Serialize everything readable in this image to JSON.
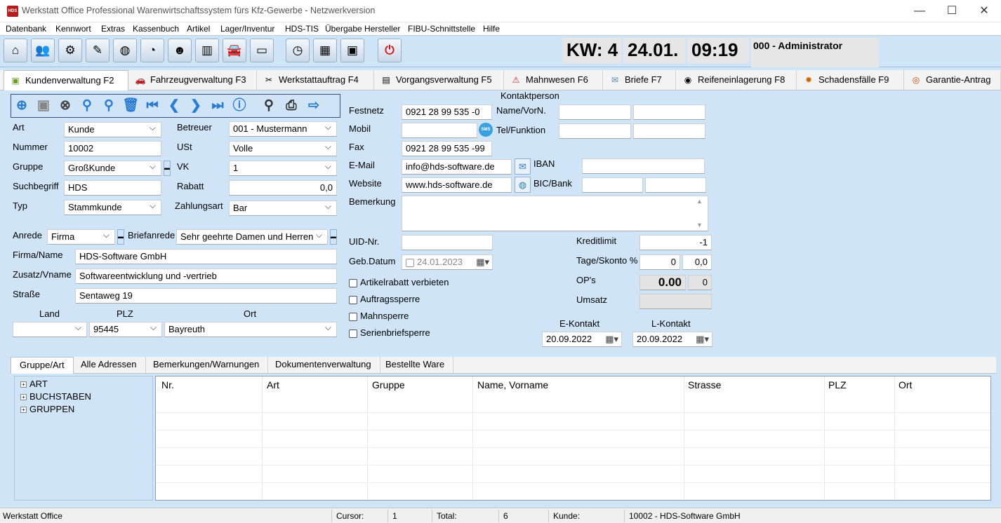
{
  "window": {
    "app_icon": "HDS",
    "title": "Werkstatt Office Professional Warenwirtschaftssystem fürs Kfz-Gewerbe - Netzwerkversion",
    "min": "—",
    "max": "☐",
    "close": "✕"
  },
  "menu": [
    "Datenbank",
    "Kennwort",
    "Extras",
    "Kassenbuch",
    "Artikel",
    "Lager/Inventur",
    "HDS-TIS",
    "Übergabe Hersteller",
    "FIBU-Schnittstelle",
    "Hilfe"
  ],
  "toolbar_icons": [
    "home-icon",
    "users-icon",
    "gear-icon",
    "notes-icon",
    "globe-icon",
    "pie-chart-icon",
    "person-icon",
    "bar-chart-icon",
    "car-icon",
    "scanner-icon",
    "clock-icon",
    "calendar-icon",
    "package-icon",
    "power-icon"
  ],
  "info": {
    "week": "KW: 4",
    "date": "24.01.",
    "time": "09:19",
    "user": "000 - Administrator"
  },
  "tabs": [
    {
      "label": "Kundenverwaltung F2",
      "icon": "customer-icon",
      "glyph": "▣",
      "active": true
    },
    {
      "label": "Fahrzeugverwaltung F3",
      "icon": "car-icon",
      "glyph": "🚗",
      "active": false
    },
    {
      "label": "Werkstattauftrag F4",
      "icon": "tools-icon",
      "glyph": "✂",
      "active": false
    },
    {
      "label": "Vorgangsverwaltung F5",
      "icon": "document-icon",
      "glyph": "▤",
      "active": false
    },
    {
      "label": "Mahnwesen F6",
      "icon": "warning-icon",
      "glyph": "⚠",
      "active": false
    },
    {
      "label": "Briefe F7",
      "icon": "envelope-icon",
      "glyph": "✉",
      "active": false
    },
    {
      "label": "Reifeneinlagerung F8",
      "icon": "tire-icon",
      "glyph": "◉",
      "active": false
    },
    {
      "label": "Schadensfälle F9",
      "icon": "damage-icon",
      "glyph": "✹",
      "active": false
    },
    {
      "label": "Garantie-Antrag",
      "icon": "warranty-icon",
      "glyph": "◎",
      "active": false
    }
  ],
  "form": {
    "art": {
      "label": "Art",
      "value": "Kunde"
    },
    "nummer": {
      "label": "Nummer",
      "value": "10002"
    },
    "gruppe": {
      "label": "Gruppe",
      "value": "GroßKunde"
    },
    "suchbegriff": {
      "label": "Suchbegriff",
      "value": "HDS"
    },
    "typ": {
      "label": "Typ",
      "value": "Stammkunde"
    },
    "betreuer": {
      "label": "Betreuer",
      "value": "001 - Mustermann"
    },
    "ust": {
      "label": "USt",
      "value": "Volle"
    },
    "vk": {
      "label": "VK",
      "value": "1"
    },
    "rabatt": {
      "label": "Rabatt",
      "value": "0,0"
    },
    "zahlungsart": {
      "label": "Zahlungsart",
      "value": "Bar"
    },
    "anrede": {
      "label": "Anrede",
      "value": "Firma"
    },
    "briefanrede": {
      "label": "Briefanrede",
      "value": "Sehr geehrte Damen und Herren"
    },
    "firma": {
      "label": "Firma/Name",
      "value": "HDS-Software GmbH"
    },
    "zusatz": {
      "label": "Zusatz/Vname",
      "value": "Softwareentwicklung und -vertrieb"
    },
    "strasse": {
      "label": "Straße",
      "value": "Sentaweg 19"
    },
    "land": {
      "label": "Land",
      "value": ""
    },
    "plz": {
      "label": "PLZ",
      "value": "95445"
    },
    "ort": {
      "label": "Ort",
      "value": "Bayreuth"
    }
  },
  "contact": {
    "kontaktperson": "Kontaktperson",
    "festnetz": {
      "label": "Festnetz",
      "value": "0921 28 99 535 -0"
    },
    "mobil": {
      "label": "Mobil",
      "value": ""
    },
    "sms": "SMS",
    "fax": {
      "label": "Fax",
      "value": "0921 28 99 535 -99"
    },
    "email": {
      "label": "E-Mail",
      "value": "info@hds-software.de"
    },
    "website": {
      "label": "Website",
      "value": "www.hds-software.de"
    },
    "bemerkung": {
      "label": "Bemerkung",
      "value": ""
    },
    "uid": {
      "label": "UID-Nr.",
      "value": ""
    },
    "geb": {
      "label": "Geb.Datum",
      "value": "24.01.2023"
    },
    "name_vorn": "Name/VorN.",
    "tel_funktion": "Tel/Funktion",
    "iban": "IBAN",
    "bic": "BIC/Bank",
    "checkboxes": [
      "Artikelrabatt verbieten",
      "Auftragssperre",
      "Mahnsperre",
      "Serienbriefsperre"
    ]
  },
  "finance": {
    "kreditlimit": {
      "label": "Kreditlimit",
      "value": "-1"
    },
    "skonto": {
      "label": "Tage/Skonto %",
      "days": "0",
      "percent": "0,0"
    },
    "ops": {
      "label": "OP's",
      "value": "0.00",
      "count": "0"
    },
    "umsatz": {
      "label": "Umsatz",
      "value": ""
    },
    "ekontakt": {
      "label": "E-Kontakt",
      "value": "20.09.2022"
    },
    "lkontakt": {
      "label": "L-Kontakt",
      "value": "20.09.2022"
    }
  },
  "bottom_tabs": [
    "Gruppe/Art",
    "Alle Adressen",
    "Bemerkungen/Warnungen",
    "Dokumentenverwaltung",
    "Bestellte Ware"
  ],
  "tree": [
    "ART",
    "BUCHSTABEN",
    "GRUPPEN"
  ],
  "grid_columns": [
    "Nr.",
    "Art",
    "Gruppe",
    "Name, Vorname",
    "Strasse",
    "PLZ",
    "Ort"
  ],
  "status": {
    "app": "Werkstatt Office",
    "cursor_label": "Cursor:",
    "cursor": "1",
    "total_label": "Total:",
    "total": "6",
    "kunde_label": "Kunde:",
    "kunde": "10002 - HDS-Software GmbH"
  }
}
